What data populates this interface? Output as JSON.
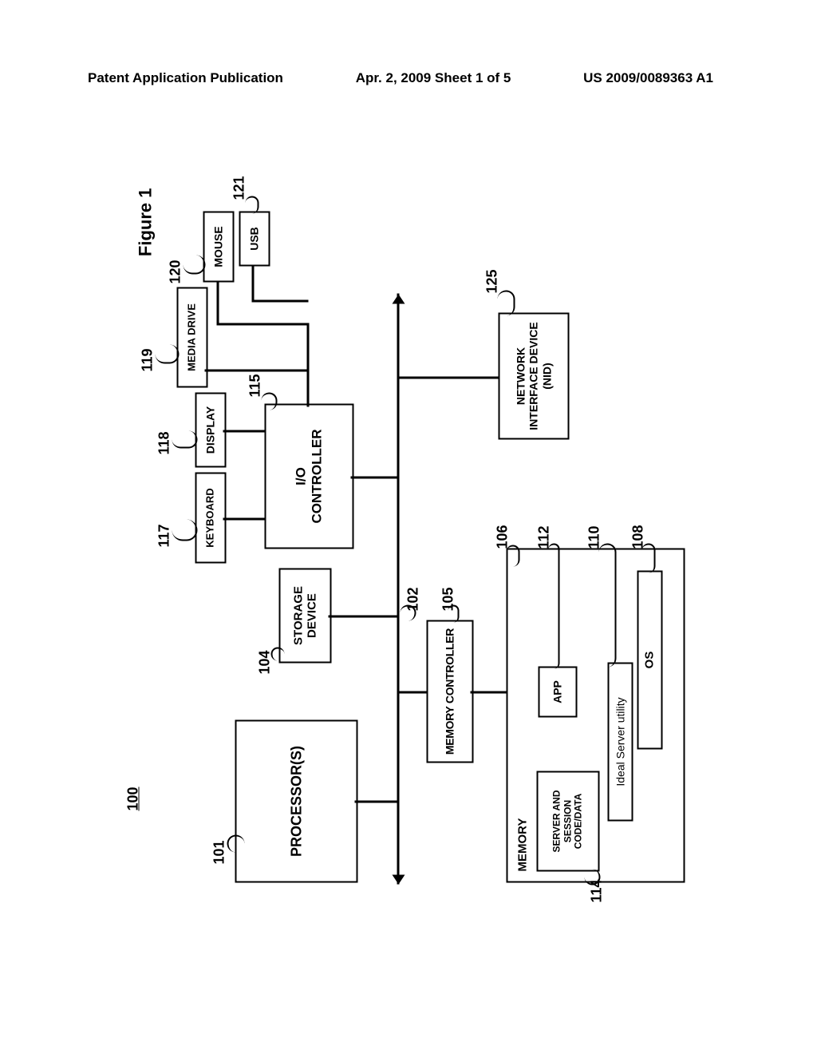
{
  "header": {
    "left": "Patent Application Publication",
    "mid": "Apr. 2, 2009  Sheet 1 of 5",
    "right": "US 2009/0089363 A1"
  },
  "fig": {
    "title": "Figure 1",
    "sys": "100"
  },
  "b": {
    "proc": "PROCESSOR(S)",
    "memctl": "MEMORY CONTROLLER",
    "stor": "STORAGE\nDEVICE",
    "ioctl": "I/O\nCONTROLLER",
    "kbd": "KEYBOARD",
    "disp": "DISPLAY",
    "media": "MEDIA DRIVE",
    "mouse": "MOUSE",
    "usb": "USB",
    "nid": "NETWORK\nINTERFACE DEVICE\n(NID)",
    "mem": "MEMORY",
    "sess": "SERVER AND\nSESSION\nCODE/DATA",
    "app": "APP",
    "ideal": "Ideal Server utility",
    "os": "OS"
  },
  "r": {
    "proc": "101",
    "memctl": "105",
    "bus": "102",
    "stor": "104",
    "ioctl": "115",
    "kbd": "117",
    "disp": "118",
    "media": "119",
    "mouse": "120",
    "usb": "121",
    "nid": "125",
    "mem": "106",
    "sess": "114",
    "app": "112",
    "ideal": "110",
    "os": "108"
  },
  "chart_data": {
    "type": "block-diagram",
    "title": "Figure 1",
    "system_ref": "100",
    "blocks": [
      {
        "ref": "101",
        "label": "PROCESSOR(S)"
      },
      {
        "ref": "105",
        "label": "MEMORY CONTROLLER"
      },
      {
        "ref": "104",
        "label": "STORAGE DEVICE"
      },
      {
        "ref": "115",
        "label": "I/O CONTROLLER"
      },
      {
        "ref": "117",
        "label": "KEYBOARD"
      },
      {
        "ref": "118",
        "label": "DISPLAY"
      },
      {
        "ref": "119",
        "label": "MEDIA DRIVE"
      },
      {
        "ref": "120",
        "label": "MOUSE"
      },
      {
        "ref": "121",
        "label": "USB"
      },
      {
        "ref": "125",
        "label": "NETWORK INTERFACE DEVICE (NID)"
      },
      {
        "ref": "106",
        "label": "MEMORY",
        "contains": [
          "114",
          "112",
          "110",
          "108"
        ]
      },
      {
        "ref": "114",
        "label": "SERVER AND SESSION CODE/DATA"
      },
      {
        "ref": "112",
        "label": "APP"
      },
      {
        "ref": "110",
        "label": "Ideal Server utility"
      },
      {
        "ref": "108",
        "label": "OS"
      }
    ],
    "bus_ref": "102",
    "connections": [
      [
        "101",
        "102"
      ],
      [
        "105",
        "102"
      ],
      [
        "104",
        "102"
      ],
      [
        "115",
        "102"
      ],
      [
        "125",
        "102"
      ],
      [
        "105",
        "106"
      ],
      [
        "115",
        "117"
      ],
      [
        "115",
        "118"
      ],
      [
        "115",
        "119"
      ],
      [
        "115",
        "120"
      ],
      [
        "115",
        "121"
      ]
    ]
  }
}
